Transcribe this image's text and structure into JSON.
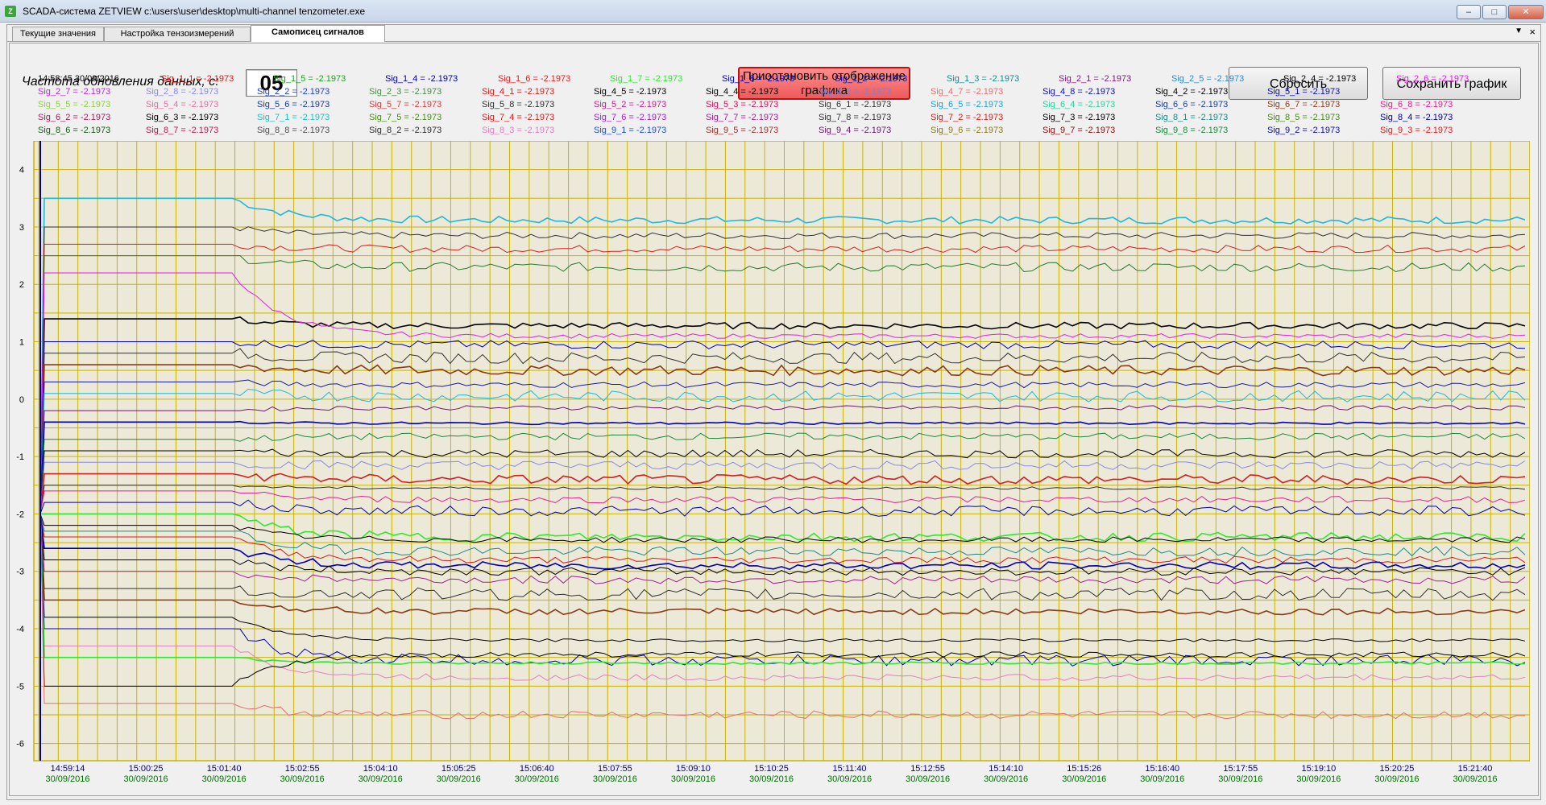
{
  "window": {
    "title": "SCADA-система ZETVIEW c:\\users\\user\\desktop\\multi-channel tenzometer.exe",
    "controls": [
      "minimize",
      "maximize",
      "close"
    ]
  },
  "tabs": [
    {
      "label": "Текущие значения",
      "active": false
    },
    {
      "label": "Настройка тензоизмерений",
      "active": false
    },
    {
      "label": "Самописец сигналов",
      "active": true
    }
  ],
  "toolbar": {
    "rate_label": "Частота обновления данных, с:",
    "rate_value": "05",
    "pause_label": "Приостановить отображение\nграфика",
    "reset_label": "Сбросить",
    "save_label": "Сохранить график"
  },
  "legend": {
    "timestamp": "14:58:45 30/09/2016",
    "rows": [
      [
        {
          "text": "Sig_1_1 = -2.1973",
          "color": "#d01c1c"
        },
        {
          "text": "Sig_1_5 = -2.1973",
          "color": "#21a021"
        },
        {
          "text": "Sig_1_4 = -2.1973",
          "color": "#0000a0"
        },
        {
          "text": "Sig_1_6 = -2.1973",
          "color": "#e02020"
        },
        {
          "text": "Sig_1_7 = -2.1973",
          "color": "#33e633"
        },
        {
          "text": "Sig_1_8 = -2.1973",
          "color": "#0000b0"
        },
        {
          "text": "Sig_1_2 = -2.1973",
          "color": "#1010a0"
        },
        {
          "text": "Sig_1_3 = -2.1973",
          "color": "#1a8a8a"
        },
        {
          "text": "Sig_2_1 = -2.1973",
          "color": "#7a1a7a"
        },
        {
          "text": "Sig_2_5 = -2.1973",
          "color": "#2a8ad0"
        },
        {
          "text": "Sig_2_4 = -2.1973",
          "color": "#000000"
        },
        {
          "text": "Sig_2_6 = -2.1973",
          "color": "#e020e0"
        }
      ],
      [
        {
          "text": "Sig_2_7 = -2.1973",
          "color": "#b030d0"
        },
        {
          "text": "Sig_2_8 = -2.1973",
          "color": "#8a8ae0"
        },
        {
          "text": "Sig_2_2 = -2.1973",
          "color": "#2040d0"
        },
        {
          "text": "Sig_2_3 = -2.1973",
          "color": "#4a8a4a"
        },
        {
          "text": "Sig_4_1 = -2.1973",
          "color": "#d02020"
        },
        {
          "text": "Sig_4_5 = -2.1973",
          "color": "#000000"
        },
        {
          "text": "Sig_4_4 = -2.1973",
          "color": "#000000"
        },
        {
          "text": "Sig_4_6 = -2.1973",
          "color": "#8080d0"
        },
        {
          "text": "Sig_4_7 = -2.1973",
          "color": "#e07070"
        },
        {
          "text": "Sig_4_8 = -2.1973",
          "color": "#1010a0"
        },
        {
          "text": "Sig_4_2 = -2.1973",
          "color": "#000000"
        },
        {
          "text": "Sig_5_1 = -2.1973",
          "color": "#1010a0"
        }
      ],
      [
        {
          "text": "Sig_5_5 = -2.1973",
          "color": "#8ad040"
        },
        {
          "text": "Sig_5_4 = -2.1973",
          "color": "#e070a0"
        },
        {
          "text": "Sig_5_6 = -2.1973",
          "color": "#1a3a9a"
        },
        {
          "text": "Sig_5_7 = -2.1973",
          "color": "#d04040"
        },
        {
          "text": "Sig_5_8 = -2.1973",
          "color": "#303030"
        },
        {
          "text": "Sig_5_2 = -2.1973",
          "color": "#c02090"
        },
        {
          "text": "Sig_5_3 = -2.1973",
          "color": "#d01060"
        },
        {
          "text": "Sig_6_1 = -2.1973",
          "color": "#303030"
        },
        {
          "text": "Sig_6_5 = -2.1973",
          "color": "#20a0d0"
        },
        {
          "text": "Sig_6_4 = -2.1973",
          "color": "#30d0a0"
        },
        {
          "text": "Sig_6_6 = -2.1973",
          "color": "#1a3a9a"
        },
        {
          "text": "Sig_6_7 = -2.1973",
          "color": "#8a3a1a"
        },
        {
          "text": "Sig_6_8 = -2.1973",
          "color": "#e02090"
        }
      ],
      [
        {
          "text": "Sig_6_2 = -2.1973",
          "color": "#a02060"
        },
        {
          "text": "Sig_6_3 = -2.1973",
          "color": "#000000"
        },
        {
          "text": "Sig_7_1 = -2.1973",
          "color": "#20c0c0"
        },
        {
          "text": "Sig_7_5 = -2.1973",
          "color": "#4a8a1a"
        },
        {
          "text": "Sig_7_4 = -2.1973",
          "color": "#d02020"
        },
        {
          "text": "Sig_7_6 = -2.1973",
          "color": "#a020d0"
        },
        {
          "text": "Sig_7_7 = -2.1973",
          "color": "#a02090"
        },
        {
          "text": "Sig_7_8 = -2.1973",
          "color": "#303030"
        },
        {
          "text": "Sig_7_2 = -2.1973",
          "color": "#d02020"
        },
        {
          "text": "Sig_7_3 = -2.1973",
          "color": "#000000"
        },
        {
          "text": "Sig_8_1 = -2.1973",
          "color": "#1a8a8a"
        },
        {
          "text": "Sig_8_5 = -2.1973",
          "color": "#4a8a1a"
        },
        {
          "text": "Sig_8_4 = -2.1973",
          "color": "#0000a0"
        }
      ],
      [
        {
          "text": "Sig_8_6 = -2.1973",
          "color": "#1a5a1a"
        },
        {
          "text": "Sig_8_7 = -2.1973",
          "color": "#b02050"
        },
        {
          "text": "Sig_8_8 = -2.1973",
          "color": "#505050"
        },
        {
          "text": "Sig_8_2 = -2.1973",
          "color": "#303030"
        },
        {
          "text": "Sig_8_3 = -2.1973",
          "color": "#e080c0"
        },
        {
          "text": "Sig_9_1 = -2.1973",
          "color": "#2050d0"
        },
        {
          "text": "Sig_9_5 = -2.1973",
          "color": "#a03030"
        },
        {
          "text": "Sig_9_4 = -2.1973",
          "color": "#6a1a6a"
        },
        {
          "text": "Sig_9_6 = -2.1973",
          "color": "#8a7a1a"
        },
        {
          "text": "Sig_9_7 = -2.1973",
          "color": "#8a1010"
        },
        {
          "text": "Sig_9_8 = -2.1973",
          "color": "#1a8a3a"
        },
        {
          "text": "Sig_9_2 = -2.1973",
          "color": "#1010a0"
        },
        {
          "text": "Sig_9_3 = -2.1973",
          "color": "#e02020"
        }
      ]
    ]
  },
  "chart_data": {
    "type": "line",
    "ylim": [
      -6.3,
      4.5
    ],
    "yticks": [
      4,
      3,
      2,
      1,
      0,
      -1,
      -2,
      -3,
      -4,
      -5,
      -6
    ],
    "xticks": [
      {
        "time": "14:59:14",
        "date": "30/09/2016"
      },
      {
        "time": "15:00:25",
        "date": "30/09/2016"
      },
      {
        "time": "15:01:40",
        "date": "30/09/2016"
      },
      {
        "time": "15:02:55",
        "date": "30/09/2016"
      },
      {
        "time": "15:04:10",
        "date": "30/09/2016"
      },
      {
        "time": "15:05:25",
        "date": "30/09/2016"
      },
      {
        "time": "15:06:40",
        "date": "30/09/2016"
      },
      {
        "time": "15:07:55",
        "date": "30/09/2016"
      },
      {
        "time": "15:09:10",
        "date": "30/09/2016"
      },
      {
        "time": "15:10:25",
        "date": "30/09/2016"
      },
      {
        "time": "15:11:40",
        "date": "30/09/2016"
      },
      {
        "time": "15:12:55",
        "date": "30/09/2016"
      },
      {
        "time": "15:14:10",
        "date": "30/09/2016"
      },
      {
        "time": "15:15:26",
        "date": "30/09/2016"
      },
      {
        "time": "15:16:40",
        "date": "30/09/2016"
      },
      {
        "time": "15:17:55",
        "date": "30/09/2016"
      },
      {
        "time": "15:19:10",
        "date": "30/09/2016"
      },
      {
        "time": "15:20:25",
        "date": "30/09/2016"
      },
      {
        "time": "15:21:40",
        "date": "30/09/2016"
      }
    ],
    "grid": true,
    "colors": {
      "background": "#ece9d8",
      "grid": "#c8b400",
      "axis": "#0000a0",
      "tick_time": "#000080",
      "tick_date": "#007000"
    },
    "series": [
      {
        "color": "#20b8d8",
        "init": 3.5,
        "final": 3.12
      },
      {
        "color": "#303030",
        "init": 3.0,
        "final": 2.85
      },
      {
        "color": "#d02020",
        "init": 2.7,
        "final": 2.62
      },
      {
        "color": "#2a7a2a",
        "init": 2.5,
        "final": 2.3
      },
      {
        "color": "#000000",
        "init": 1.4,
        "final": 1.28
      },
      {
        "color": "#e020e0",
        "init": 2.2,
        "final": 1.1
      },
      {
        "color": "#0000b0",
        "init": 1.0,
        "final": 0.95
      },
      {
        "color": "#303030",
        "init": 0.8,
        "final": 0.72
      },
      {
        "color": "#8a3a1a",
        "init": 0.6,
        "final": 0.5
      },
      {
        "color": "#1a1aa0",
        "init": 0.3,
        "final": 0.25
      },
      {
        "color": "#20b8d8",
        "init": 0.1,
        "final": 0.05
      },
      {
        "color": "#6a1a6a",
        "init": -0.2,
        "final": -0.15
      },
      {
        "color": "#0000b0",
        "init": -0.4,
        "final": -0.42
      },
      {
        "color": "#1a8a3a",
        "init": -0.7,
        "final": -0.65
      },
      {
        "color": "#000000",
        "init": -0.9,
        "final": -0.95
      },
      {
        "color": "#8a8ae0",
        "init": -1.1,
        "final": -1.15
      },
      {
        "color": "#d02020",
        "init": -1.3,
        "final": -1.4
      },
      {
        "color": "#303030",
        "init": -1.5,
        "final": -1.55
      },
      {
        "color": "#e02090",
        "init": -1.6,
        "final": -1.75
      },
      {
        "color": "#0000b0",
        "init": -1.8,
        "final": -1.95
      },
      {
        "color": "#33e633",
        "init": -2.0,
        "final": -2.4
      },
      {
        "color": "#000000",
        "init": -2.2,
        "final": -2.45
      },
      {
        "color": "#1a8a8a",
        "init": -2.3,
        "final": -2.65
      },
      {
        "color": "#d02020",
        "init": -2.4,
        "final": -2.8
      },
      {
        "color": "#0000b0",
        "init": -2.6,
        "final": -2.9
      },
      {
        "color": "#000000",
        "init": -2.8,
        "final": -3.0
      },
      {
        "color": "#a02090",
        "init": -3.0,
        "final": -3.15
      },
      {
        "color": "#303030",
        "init": -3.3,
        "final": -3.4
      },
      {
        "color": "#8a3a1a",
        "init": -3.5,
        "final": -3.7
      },
      {
        "color": "#000000",
        "init": -3.8,
        "final": -4.2
      },
      {
        "color": "#0000b0",
        "init": -4.0,
        "final": -4.55
      },
      {
        "color": "#e080c0",
        "init": -4.3,
        "final": -4.85
      },
      {
        "color": "#33e633",
        "init": -4.5,
        "final": -4.6
      },
      {
        "color": "#000000",
        "init": -5.0,
        "final": -4.45
      },
      {
        "color": "#e07070",
        "init": -5.3,
        "final": -5.5
      }
    ]
  }
}
